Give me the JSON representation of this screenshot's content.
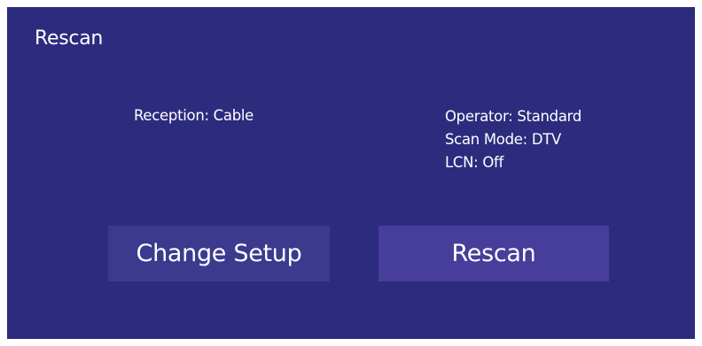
{
  "dialog": {
    "title": "Rescan",
    "reception": "Reception: Cable",
    "details": [
      "Operator: Standard",
      "Scan Mode: DTV",
      "LCN: Off"
    ],
    "buttons": {
      "change_setup": "Change Setup",
      "rescan": "Rescan"
    }
  },
  "colors": {
    "background": "#2d2b7e",
    "button": "#3c3a8f",
    "button_focused": "#473d9a",
    "text": "#ffffff"
  }
}
